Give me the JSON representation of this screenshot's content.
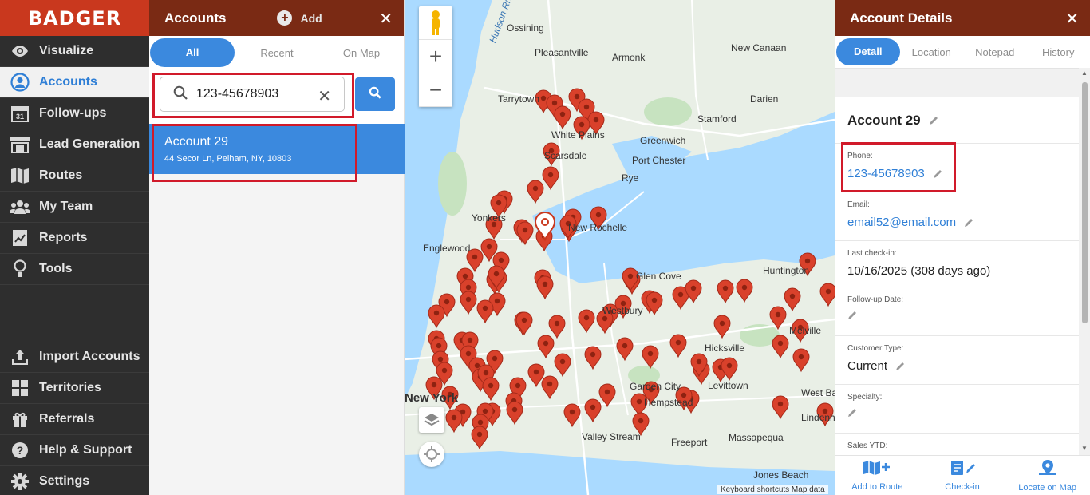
{
  "app": {
    "logo_text": "BADGER"
  },
  "sidebar": {
    "items": [
      {
        "label": "Visualize",
        "icon": "eye-icon"
      },
      {
        "label": "Accounts",
        "icon": "user-circle-icon",
        "active": true
      },
      {
        "label": "Follow-ups",
        "icon": "calendar-icon"
      },
      {
        "label": "Lead Generation",
        "icon": "storefront-icon"
      },
      {
        "label": "Routes",
        "icon": "map-icon"
      },
      {
        "label": "My Team",
        "icon": "team-icon"
      },
      {
        "label": "Reports",
        "icon": "report-icon"
      },
      {
        "label": "Tools",
        "icon": "lightbulb-icon"
      }
    ],
    "bottom_items": [
      {
        "label": "Import Accounts",
        "icon": "upload-icon"
      },
      {
        "label": "Territories",
        "icon": "territories-icon"
      },
      {
        "label": "Referrals",
        "icon": "gift-icon"
      },
      {
        "label": "Help & Support",
        "icon": "help-icon"
      },
      {
        "label": "Settings",
        "icon": "gear-icon"
      }
    ]
  },
  "accounts_panel": {
    "title": "Accounts",
    "add_label": "Add",
    "tabs": [
      "All",
      "Recent",
      "On Map"
    ],
    "active_tab": "All",
    "search_value": "123-45678903",
    "results": [
      {
        "name": "Account 29",
        "address": "44 Secor Ln, Pelham, NY, 10803"
      }
    ]
  },
  "map": {
    "labels": [
      "Ossining",
      "Pleasantville",
      "Armonk",
      "New Canaan",
      "Tarrytown",
      "Darien",
      "Stamford",
      "White Plains",
      "Greenwich",
      "Scarsdale",
      "Port Chester",
      "Rye",
      "Yonkers",
      "New Rochelle",
      "Englewood",
      "Glen Cove",
      "Huntington",
      "Hicksville",
      "Levittown",
      "Garden City",
      "Hempstead",
      "Valley Stream",
      "Freeport",
      "Massapequa",
      "West Babylon",
      "Lindenhurst",
      "Jones Beach",
      "New York",
      "Westbury",
      "Melville",
      "Hudson River"
    ],
    "attribution": "Keyboard shortcuts   Map data"
  },
  "details": {
    "title": "Account Details",
    "tabs": [
      "Detail",
      "Location",
      "Notepad",
      "History"
    ],
    "active_tab": "Detail",
    "account_name": "Account 29",
    "fields": [
      {
        "label": "Phone:",
        "value": "123-45678903",
        "link": true
      },
      {
        "label": "Email:",
        "value": "email52@email.com",
        "link": true
      },
      {
        "label": "Last check-in:",
        "value": "10/16/2025 (308 days ago)",
        "link": false
      },
      {
        "label": "Follow-up Date:",
        "value": "",
        "link": false
      },
      {
        "label": "Customer Type:",
        "value": "Current",
        "link": false
      },
      {
        "label": "Specialty:",
        "value": "",
        "link": false
      },
      {
        "label": "Sales YTD:",
        "value": "",
        "link": false
      }
    ],
    "actions": [
      {
        "label": "Add to Route",
        "icon": "add-route-icon"
      },
      {
        "label": "Check-in",
        "icon": "checkin-icon"
      },
      {
        "label": "Locate on Map",
        "icon": "locate-pin-icon"
      }
    ]
  }
}
